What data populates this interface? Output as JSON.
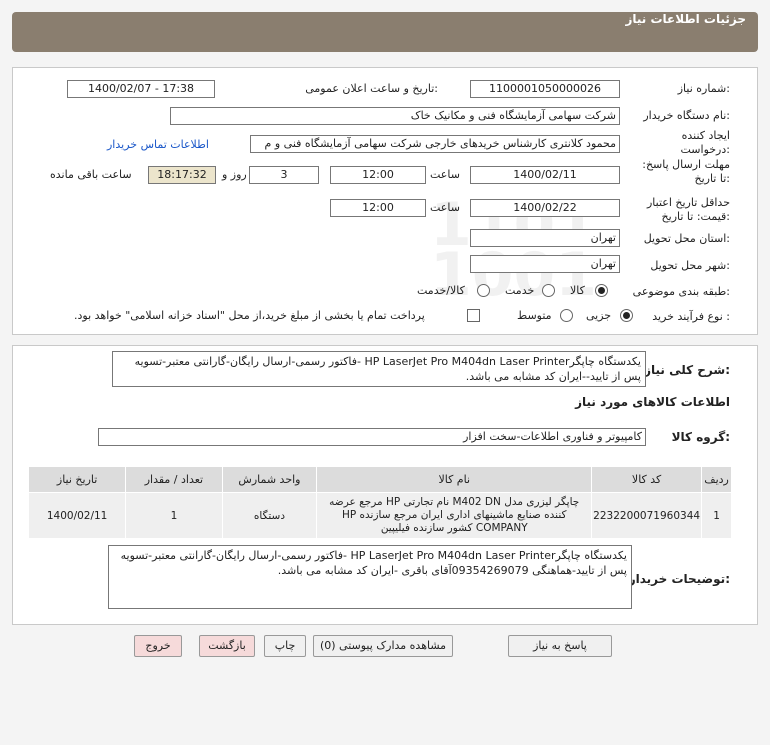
{
  "header": {
    "title": "جزئیات اطلاعات نیاز"
  },
  "form": {
    "need_number_label": "شماره نیاز:",
    "need_number": "1100001050000026",
    "announce_label": "تاریخ و ساعت اعلان عمومی:",
    "announce_value": "1400/02/07 - 17:38",
    "buyer_org_label": "نام دستگاه خریدار:",
    "buyer_org": "شرکت سهامی آزمایشگاه فنی و مکانیک خاک",
    "creator_label": "ایجاد کننده درخواست:",
    "creator": "محمود کلانتری کارشناس خریدهای خارجی  شرکت سهامی آزمایشگاه فنی و م",
    "contact_link": "اطلاعات تماس خریدار",
    "reply_deadline_label": "مهلت ارسال پاسخ: تا تاریخ:",
    "reply_date": "1400/02/11",
    "time_label": "ساعت",
    "reply_time": "12:00",
    "days": "3",
    "days_label": "روز و",
    "remaining_time": "18:17:32",
    "remaining_label": "ساعت باقی مانده",
    "price_validity_label": "حداقل تاریخ اعتبار قیمت: تا تاریخ:",
    "validity_date": "1400/02/22",
    "validity_time": "12:00",
    "province_label": "استان محل تحویل:",
    "province": "تهران",
    "city_label": "شهر محل تحویل:",
    "city": "تهران",
    "category_label": "طبقه بندی موضوعی:",
    "category_options": [
      "کالا",
      "خدمت",
      "کالا/خدمت"
    ],
    "purchase_type_label": "نوع فرآیند خرید :",
    "purchase_options": [
      "جزیی",
      "متوسط"
    ],
    "payment_note": "پرداخت تمام یا بخشی از مبلغ خرید،از محل \"اسناد خزانه اسلامی\" خواهد بود."
  },
  "description": {
    "label": "شرح کلی نیاز:",
    "text": "یکدستگاه چاپگرHP LaserJet Pro M404dn Laser Printer -فاکتور رسمی-ارسال رایگان-گارانتی معتبر-تسویه پس از تایید--ایران کد مشابه می باشد."
  },
  "goods": {
    "section_title": "اطلاعات کالاهای مورد نیاز",
    "group_label": "گروه کالا:",
    "group_value": "کامپیوتر و فناوری اطلاعات-سخت افزار",
    "columns": [
      "ردیف",
      "کد کالا",
      "نام کالا",
      "واحد شمارش",
      "تعداد / مقدار",
      "تاریخ نیاز"
    ],
    "rows": [
      {
        "index": "1",
        "code": "2232200071960344",
        "name": "چاپگر لیزری مدل M402 DN نام تجارتی HP مرجع عرضه کننده صنایع ماشینهای اداری ایران مرجع سازنده HP COMPANY کشور سازنده فیلیپین",
        "unit": "دستگاه",
        "qty": "1",
        "date": "1400/02/11"
      }
    ]
  },
  "buyer_notes": {
    "label": "توضیحات خریدار:",
    "text": "یکدستگاه چاپگرHP LaserJet Pro M404dn Laser Printer -فاکتور رسمی-ارسال رایگان-گارانتی معتبر-تسویه پس از تایید-هماهنگی 09354269079آقای باقری -ایران کد مشابه می باشد."
  },
  "buttons": {
    "reply": "پاسخ به نیاز",
    "attachments": "مشاهده مدارک پیوستی (0)",
    "print": "چاپ",
    "back": "بازگشت",
    "exit": "خروج"
  }
}
